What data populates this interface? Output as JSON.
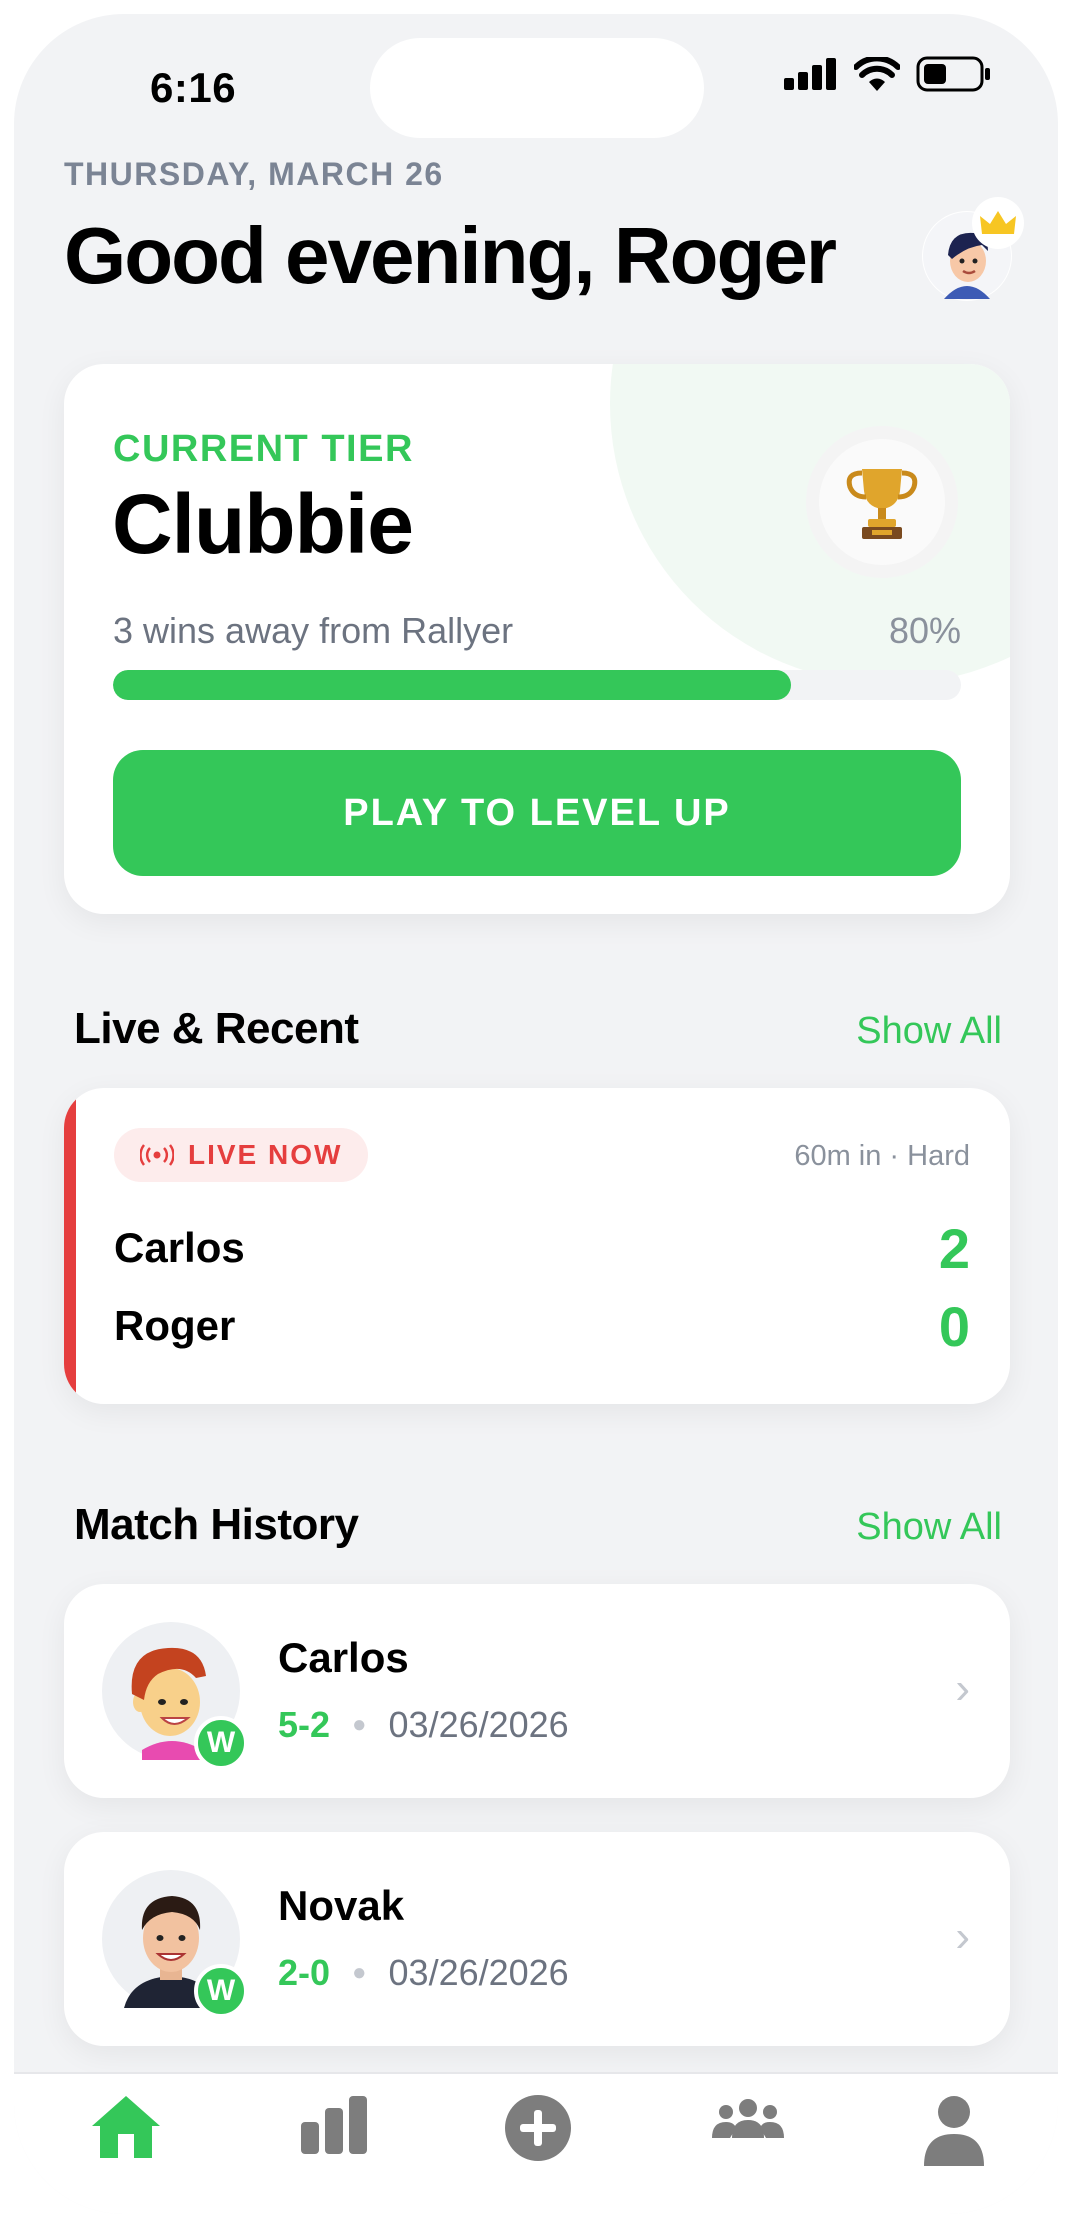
{
  "status_bar": {
    "time": "6:16"
  },
  "header": {
    "date": "THURSDAY, MARCH 26",
    "greeting": "Good evening, Roger"
  },
  "tier": {
    "label": "CURRENT TIER",
    "name": "Clubbie",
    "subtitle": "3 wins away from Rallyer",
    "percent_text": "80%",
    "progress": 0.8,
    "cta": "PLAY TO LEVEL UP"
  },
  "live_recent": {
    "title": "Live & Recent",
    "show_all": "Show All",
    "match": {
      "badge": "LIVE NOW",
      "meta": "60m in · Hard",
      "players": [
        {
          "name": "Carlos",
          "score": "2"
        },
        {
          "name": "Roger",
          "score": "0"
        }
      ]
    }
  },
  "history": {
    "title": "Match History",
    "show_all": "Show All",
    "matches": [
      {
        "opponent": "Carlos",
        "score": "5-2",
        "date": "03/26/2026",
        "result": "W"
      },
      {
        "opponent": "Novak",
        "score": "2-0",
        "date": "03/26/2026",
        "result": "W"
      }
    ]
  },
  "tabbar": {
    "items": [
      "home-icon",
      "stats-icon",
      "add-match-icon",
      "friends-icon",
      "profile-icon"
    ],
    "active": "home-icon"
  },
  "colors": {
    "accent": "#34c759",
    "live": "#e53e3e",
    "background": "#f2f3f5"
  }
}
